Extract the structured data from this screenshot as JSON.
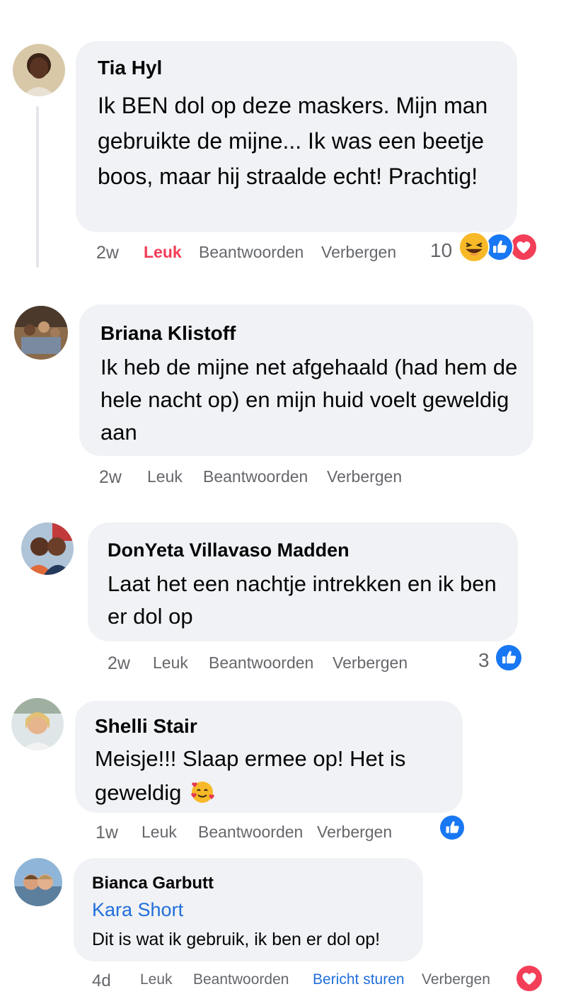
{
  "comments": [
    {
      "author": "Tia Hyl",
      "text": "Ik BEN dol op deze maskers. Mijn man gebruikte de mijne... Ik was een beetje boos, maar hij straalde echt! Prachtig!",
      "time": "2w",
      "like_label": "Leuk",
      "like_active": true,
      "reply_label": "Beantwoorden",
      "hide_label": "Verbergen",
      "reaction_count": "10",
      "reactions": [
        "laughing-emoji-icon",
        "like-icon",
        "love-icon"
      ]
    },
    {
      "author": "Briana Klistoff",
      "text": "Ik heb de mijne net afgehaald (had hem de hele nacht op) en mijn huid voelt geweldig aan",
      "time": "2w",
      "like_label": "Leuk",
      "reply_label": "Beantwoorden",
      "hide_label": "Verbergen"
    },
    {
      "author": "DonYeta Villavaso Madden",
      "text": "Laat het een nachtje intrekken en ik ben er dol op",
      "time": "2w",
      "like_label": "Leuk",
      "reply_label": "Beantwoorden",
      "hide_label": "Verbergen",
      "reaction_count": "3",
      "reactions": [
        "like-icon"
      ]
    },
    {
      "author": "Shelli Stair",
      "text": "Meisje!!! Slaap ermee op! Het is geweldig",
      "text_emoji": "smiling-face-with-hearts-emoji-icon",
      "time": "1w",
      "like_label": "Leuk",
      "reply_label": "Beantwoorden",
      "hide_label": "Verbergen",
      "reactions": [
        "like-icon"
      ]
    },
    {
      "author": "Bianca Garbutt",
      "tag": "Kara Short",
      "text": "Dit is wat ik gebruik, ik ben er dol op!",
      "time": "4d",
      "like_label": "Leuk",
      "reply_label": "Beantwoorden",
      "message_label": "Bericht sturen",
      "hide_label": "Verbergen",
      "reactions": [
        "love-icon"
      ]
    }
  ],
  "colors": {
    "bubble": "#f0f2f5",
    "meta_text": "#65676b",
    "liked": "#f33e58",
    "link_blue": "#216fdb",
    "like_blue": "#1877f2",
    "love_red": "#f33e58"
  }
}
